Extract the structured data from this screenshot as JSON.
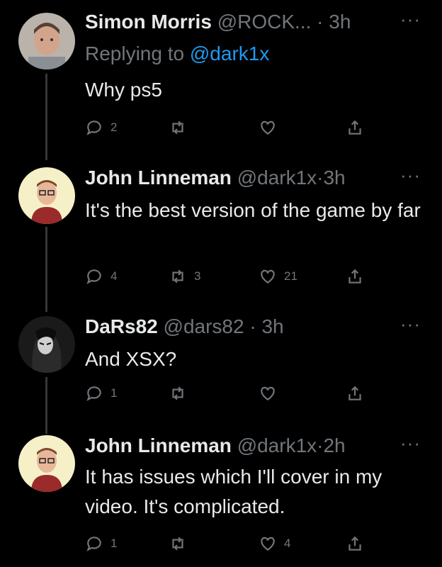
{
  "tweets": [
    {
      "name": "Simon Morris",
      "handle": "@ROCK...",
      "sep": "·",
      "time": "3h",
      "replying_prefix": "Replying to",
      "replying_to": "@dark1x",
      "text": "Why ps5",
      "replies": "2",
      "retweets": "",
      "likes": ""
    },
    {
      "name": "John Linneman",
      "handle": "@dark1x",
      "sep": "·",
      "time": "3h",
      "text": "It's the best version of the game by far",
      "replies": "4",
      "retweets": "3",
      "likes": "21"
    },
    {
      "name": "DaRs82",
      "handle": "@dars82",
      "sep": "·",
      "time": "3h",
      "text": "And XSX?",
      "replies": "1",
      "retweets": "",
      "likes": ""
    },
    {
      "name": "John Linneman",
      "handle": "@dark1x",
      "sep": "·",
      "time": "2h",
      "text": "It has issues which I'll cover in my video. It's complicated.",
      "replies": "1",
      "retweets": "",
      "likes": "4"
    }
  ],
  "more_glyph": "···",
  "icons": [
    "reply-icon",
    "retweet-icon",
    "like-icon",
    "share-icon",
    "more-icon"
  ]
}
